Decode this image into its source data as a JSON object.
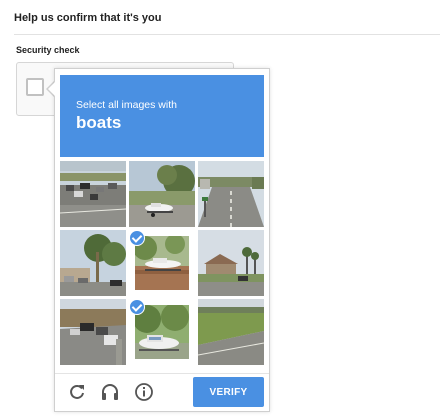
{
  "page": {
    "heading": "Help us confirm that it's you",
    "security_label": "Security check"
  },
  "captcha": {
    "instruction": "Select all images with",
    "keyword": "boats",
    "tiles": [
      {
        "row": 1,
        "col": 1,
        "selected": false
      },
      {
        "row": 1,
        "col": 2,
        "selected": false
      },
      {
        "row": 1,
        "col": 3,
        "selected": false
      },
      {
        "row": 2,
        "col": 1,
        "selected": false
      },
      {
        "row": 2,
        "col": 2,
        "selected": true
      },
      {
        "row": 2,
        "col": 3,
        "selected": false
      },
      {
        "row": 3,
        "col": 1,
        "selected": false
      },
      {
        "row": 3,
        "col": 2,
        "selected": true
      },
      {
        "row": 3,
        "col": 3,
        "selected": false
      }
    ],
    "footer": {
      "reload_icon": "reload-icon",
      "audio_icon": "headphones-icon",
      "info_icon": "info-icon",
      "verify_label": "VERIFY"
    },
    "accent_color": "#4a90e2"
  }
}
